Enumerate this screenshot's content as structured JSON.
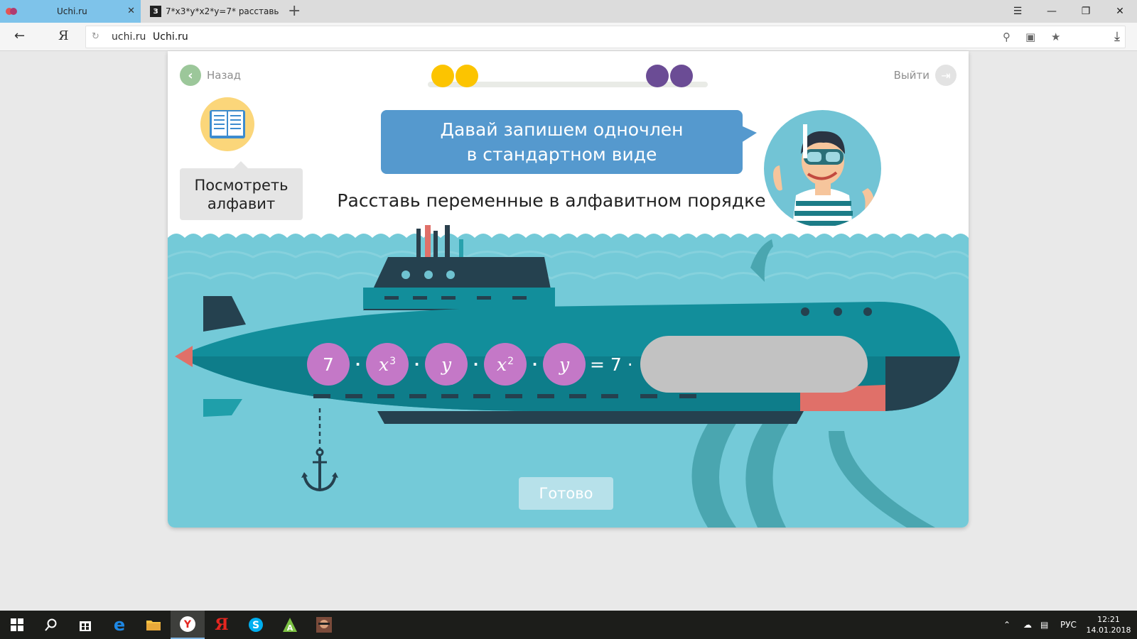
{
  "browser": {
    "tabs": [
      {
        "title": "Uchi.ru",
        "active": true
      },
      {
        "title": "7*x3*y*x2*y=7* расставь од",
        "active": false
      }
    ],
    "address": {
      "domain": "uchi.ru",
      "page_title": "Uchi.ru"
    }
  },
  "app": {
    "back_label": "Назад",
    "exit_label": "Выйти",
    "progress": {
      "colors": [
        "#fcc400",
        "#fcc400",
        "#6b4c95",
        "#6b4c95"
      ]
    },
    "alphabet_button": {
      "line1": "Посмотреть",
      "line2": "алфавит"
    },
    "speech": {
      "line1": "Давай запишем одночлен",
      "line2": "в стандартном виде"
    },
    "task": "Расставь переменные в алфавитном порядке",
    "equation": {
      "tiles": [
        {
          "base": "7",
          "exp": ""
        },
        {
          "base": "x",
          "exp": "3"
        },
        {
          "base": "y",
          "exp": ""
        },
        {
          "base": "x",
          "exp": "2"
        },
        {
          "base": "y",
          "exp": ""
        }
      ],
      "dot": "·",
      "result": "= 7 ·"
    },
    "done_label": "Готово"
  },
  "taskbar": {
    "lang": "РУС",
    "time": "12:21",
    "date": "14.01.2018"
  },
  "colors": {
    "sea": "#74cad8",
    "sub": "#128e9b",
    "tile": "#c478c7",
    "tab_active": "#7ec3ea"
  }
}
